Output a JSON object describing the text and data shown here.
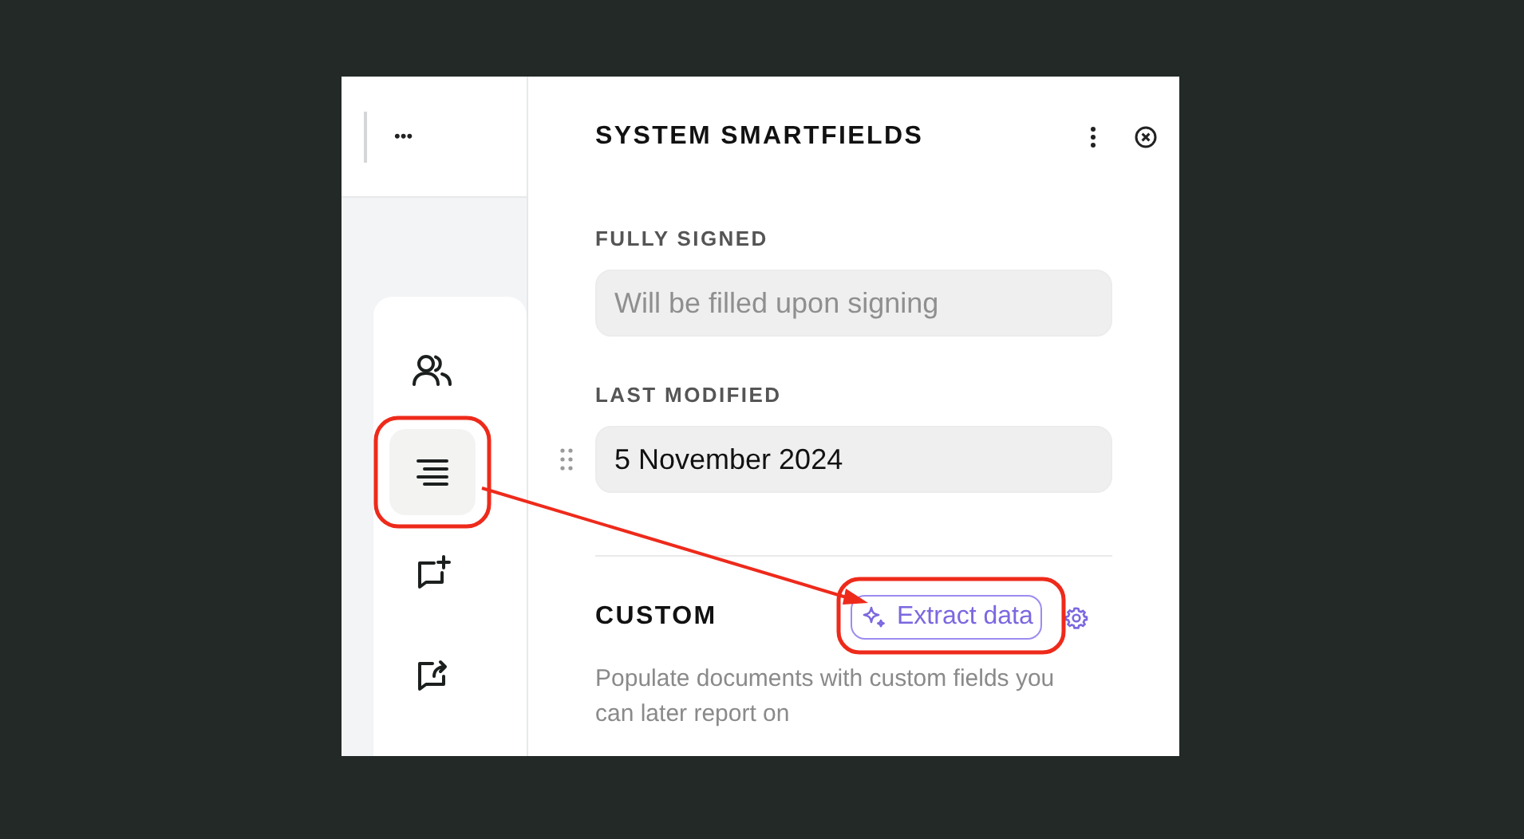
{
  "toolbar": {
    "more": "•••"
  },
  "rail": [
    {
      "selected": false,
      "highlighted": false
    },
    {
      "selected": true,
      "highlighted": true
    },
    {
      "selected": false,
      "highlighted": false
    },
    {
      "selected": false,
      "highlighted": false
    }
  ],
  "panel": {
    "title": "SYSTEM SMARTFIELDS",
    "fields": [
      {
        "label": "FULLY SIGNED",
        "placeholder": "Will be filled upon signing",
        "draggable": false
      },
      {
        "label": "LAST MODIFIED",
        "value": "5 November 2024",
        "draggable": true
      }
    ],
    "custom": {
      "title": "CUSTOM",
      "button": {
        "label": "Extract data",
        "highlighted": true
      },
      "description": "Populate documents with custom fields you can later report on"
    }
  }
}
